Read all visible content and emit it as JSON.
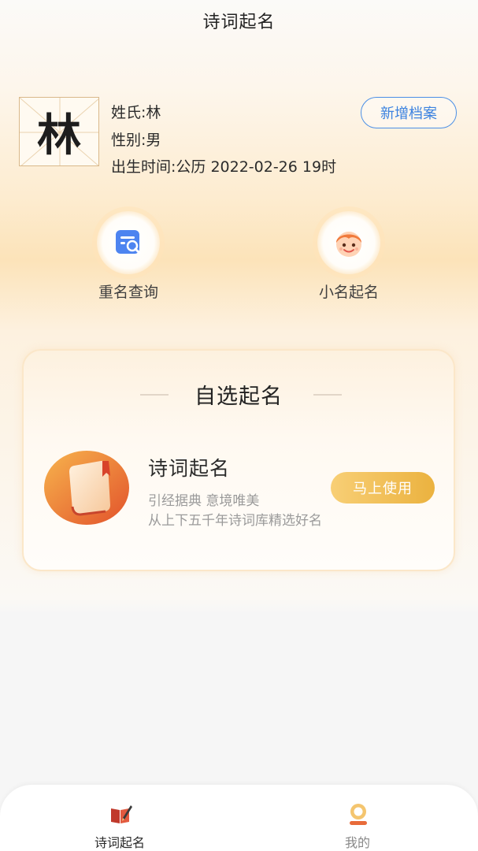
{
  "header": {
    "title": "诗词起名"
  },
  "profile": {
    "surname_char": "林",
    "surname_line": "姓氏:林",
    "gender_line": "性别:男",
    "birth_line": "出生时间:公历 2022-02-26 19时",
    "add_button_label": "新增档案"
  },
  "tools": [
    {
      "label": "重名查询",
      "icon": "search-document-icon"
    },
    {
      "label": "小名起名",
      "icon": "child-face-icon"
    }
  ],
  "card": {
    "title": "自选起名",
    "feature": {
      "name": "诗词起名",
      "desc_line1": "引经据典 意境唯美",
      "desc_line2": "从上下五千年诗词库精选好名",
      "button_label": "马上使用",
      "icon": "book-icon"
    }
  },
  "bottom_nav": [
    {
      "label": "诗词起名",
      "icon": "poetry-book-icon",
      "active": true
    },
    {
      "label": "我的",
      "icon": "profile-icon",
      "active": false
    }
  ],
  "colors": {
    "accent_blue": "#3b82e0",
    "button_gold": "#ebb23f",
    "nav_active": "#c0392b"
  }
}
